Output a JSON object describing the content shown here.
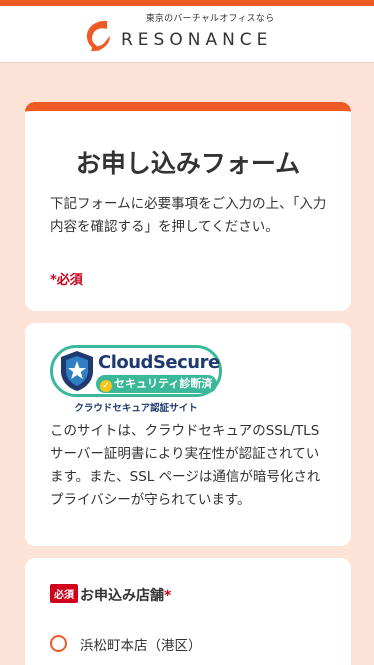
{
  "header": {
    "tagline": "東京のバーチャルオフィスなら",
    "brand": "RESONANCE",
    "accent_color": "#ee5a24"
  },
  "intro_card": {
    "title": "お申し込みフォーム",
    "description": "下記フォームに必要事項をご入力の上、「入力内容を確認する」を押してください。",
    "required_note": "*必須"
  },
  "ssl_card": {
    "badge_title": "CloudSecure",
    "badge_subtitle": "セキュリティ診断済",
    "badge_caption": "クラウドセキュア認証サイト",
    "badge_icon": "shield-check-icon",
    "description": "このサイトは、クラウドセキュアのSSL/TLS サーバー証明書により実在性が認証されています。また、SSL ページは通信が暗号化されプライバシーが守られています。"
  },
  "store_field": {
    "required_tag": "必須",
    "label": "お申込み店舗",
    "required_mark": "*",
    "options": [
      "浜松町本店（港区）"
    ]
  }
}
